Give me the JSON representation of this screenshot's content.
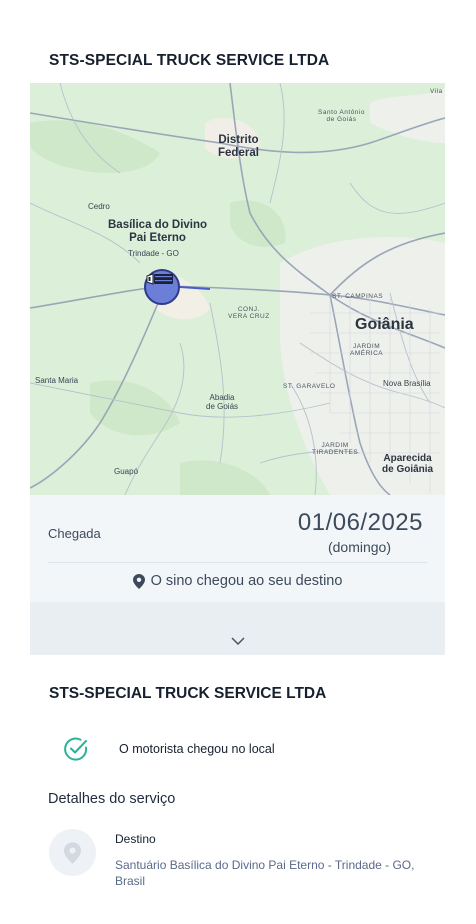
{
  "header": {
    "company_name": "STS-SPECIAL TRUCK SERVICE LTDA"
  },
  "map": {
    "labels": {
      "distrito_federal": "Distrito\nFederal",
      "santo_antonio": "Santo Antônio\nde Goiás",
      "vila": "Vila",
      "cedro": "Cedro",
      "basilica": "Basílica do Divino\nPai Eterno",
      "trindade": "Trindade - GO",
      "st_campinas": "ST. CAMPINAS",
      "goiania": "Goiânia",
      "jardim_america": "JARDIM\nAMÉRICA",
      "conj_vera_cruz": "CONJ.\nVERA CRUZ",
      "santa_maria": "Santa Maria",
      "st_garavelo": "ST. GARAVELO",
      "nova_brasilia": "Nova Brasília",
      "abadia": "Abadia\nde Goiás",
      "jardim_tiradentes": "JARDIM\nTIRADENTES",
      "aparecida": "Aparecida\nde Goiânia",
      "guapo": "Guapó"
    },
    "marker_icon": "truck-icon"
  },
  "arrival": {
    "label": "Chegada",
    "date": "01/06/2025",
    "weekday": "(domingo)",
    "status": "O sino chegou ao seu destino",
    "status_icon": "location-pin-icon"
  },
  "expand": {
    "icon": "chevron-down-icon"
  },
  "summary": {
    "company_name": "STS-SPECIAL TRUCK SERVICE LTDA",
    "driver_status": "O motorista chegou no local",
    "driver_status_icon": "check-circle-icon"
  },
  "details": {
    "title": "Detalhes do serviço",
    "destination_label": "Destino",
    "destination_value": "Santuário Basílica do Divino Pai Eterno -  Trindade - GO, Brasil",
    "destination_icon": "location-pin-icon"
  },
  "colors": {
    "map_green": "#dcefd9",
    "accent_teal": "#2bb39a",
    "marker_blue": "#6b7fd9",
    "panel_bg": "#f3f6f9"
  }
}
